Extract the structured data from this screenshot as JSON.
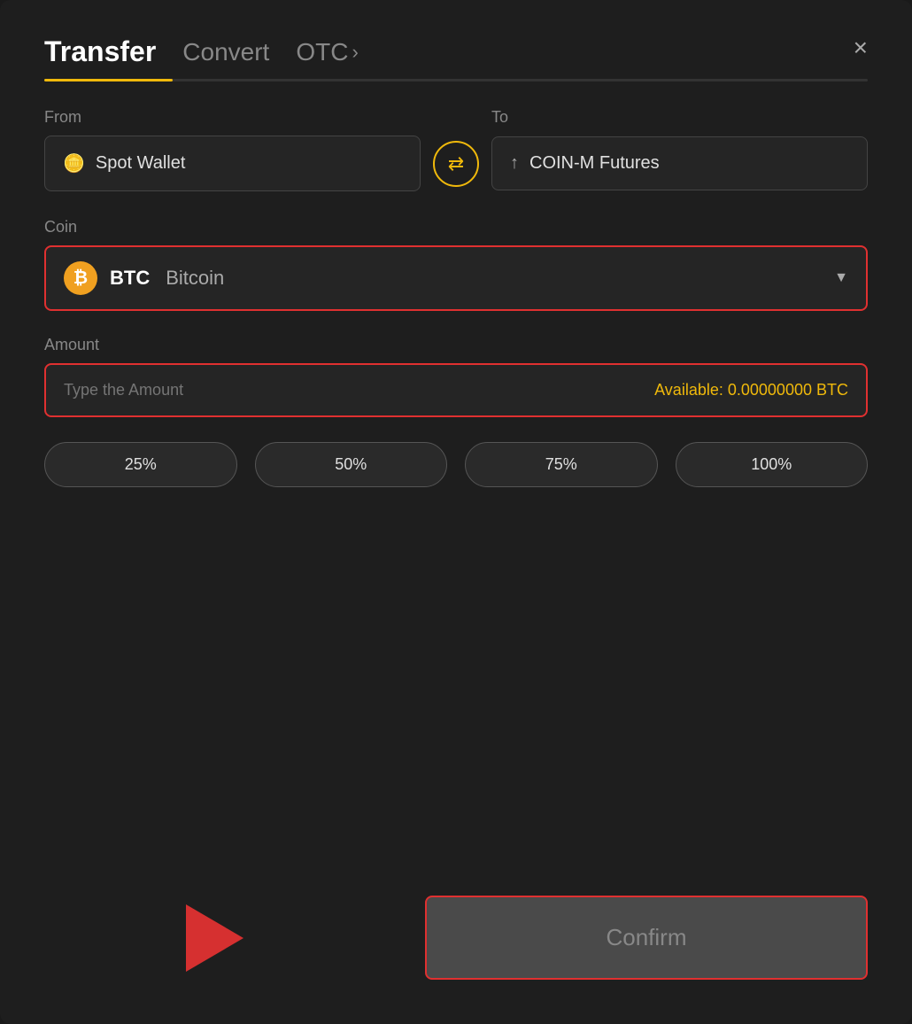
{
  "header": {
    "title": "Transfer",
    "tab_convert": "Convert",
    "tab_otc": "OTC",
    "tab_otc_chevron": "›",
    "close_icon": "×"
  },
  "from_to": {
    "from_label": "From",
    "to_label": "To",
    "from_wallet": "Spot Wallet",
    "to_wallet": "COIN-M Futures",
    "swap_icon": "⇄"
  },
  "coin": {
    "label": "Coin",
    "symbol": "BTC",
    "name": "Bitcoin",
    "icon_letter": "₿"
  },
  "amount": {
    "label": "Amount",
    "placeholder": "Type the Amount",
    "available_label": "Available:",
    "available_value": "0.00000000",
    "available_currency": "BTC"
  },
  "percentages": [
    {
      "label": "25%"
    },
    {
      "label": "50%"
    },
    {
      "label": "75%"
    },
    {
      "label": "100%"
    }
  ],
  "confirm": {
    "label": "Confirm"
  }
}
